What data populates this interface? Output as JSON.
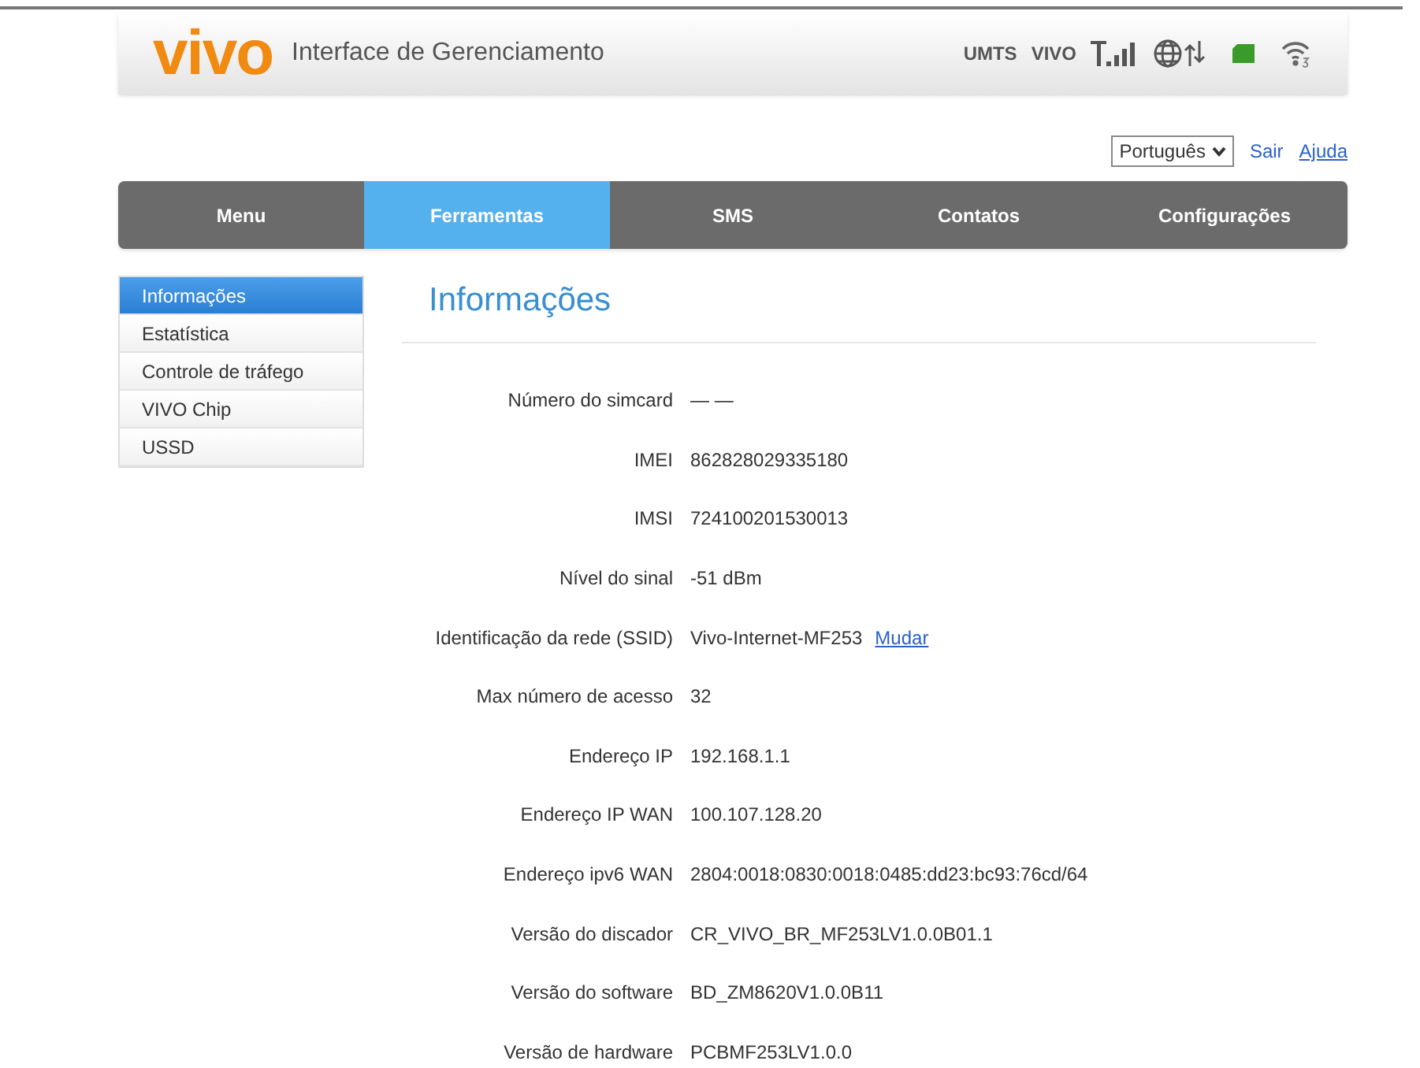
{
  "header": {
    "logo": "vivo",
    "title": "Interface de Gerenciamento",
    "network": "UMTS",
    "operator": "VIVO"
  },
  "top_links": {
    "language": "Português",
    "links": [
      "Sair",
      "Ajuda"
    ]
  },
  "tabs": [
    {
      "label": "Menu",
      "selected": false
    },
    {
      "label": "Ferramentas",
      "selected": true
    },
    {
      "label": "SMS",
      "selected": false
    },
    {
      "label": "Contatos",
      "selected": false
    },
    {
      "label": "Configurações",
      "selected": false
    }
  ],
  "sidebar": {
    "items": [
      {
        "label": "Informações",
        "selected": true
      },
      {
        "label": "Estatística",
        "selected": false
      },
      {
        "label": "Controle de tráfego",
        "selected": false
      },
      {
        "label": "VIVO Chip",
        "selected": false
      },
      {
        "label": "USSD",
        "selected": false
      }
    ]
  },
  "content": {
    "title": "Informações",
    "rows": [
      {
        "label": "Número do simcard",
        "value": "— —"
      },
      {
        "label": "IMEI",
        "value": "862828029335180"
      },
      {
        "label": "IMSI",
        "value": "724100201530013"
      },
      {
        "label": "Nível do sinal",
        "value": "-51 dBm"
      },
      {
        "label": "Identificação da rede (SSID)",
        "value": "Vivo-Internet-MF253",
        "link": "Mudar"
      },
      {
        "label": "Max número de acesso",
        "value": "32"
      },
      {
        "label": "Endereço IP",
        "value": "192.168.1.1"
      },
      {
        "label": "Endereço IP WAN",
        "value": "100.107.128.20"
      },
      {
        "label": "Endereço ipv6 WAN",
        "value": "2804:0018:0830:0018:0485:dd23:bc93:76cd/64"
      },
      {
        "label": "Versão do discador",
        "value": "CR_VIVO_BR_MF253LV1.0.0B01.1"
      },
      {
        "label": "Versão do software",
        "value": "BD_ZM8620V1.0.0B11"
      },
      {
        "label": "Versão de hardware",
        "value": "PCBMF253LV1.0.0"
      }
    ]
  }
}
